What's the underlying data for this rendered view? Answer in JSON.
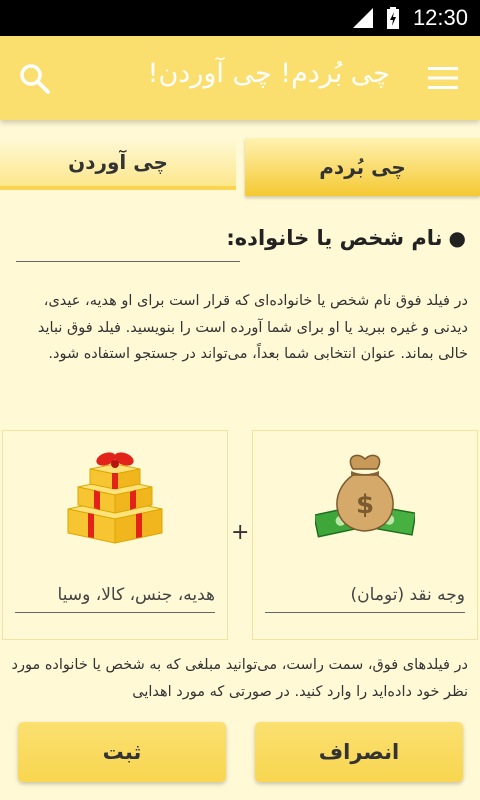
{
  "status": {
    "time": "12:30"
  },
  "appbar": {
    "title": "چی بُردم! چی آوردن!",
    "search_icon": "search-icon",
    "menu_icon": "menu-icon"
  },
  "tabs": [
    {
      "label": "چی آوردن",
      "selected": false
    },
    {
      "label": "چی بُردم",
      "selected": true
    }
  ],
  "form": {
    "name_label": "نام شخص یا خانواده:",
    "name_value": "",
    "description": "در فیلد فوق نام شخص یا خانواده‌ای که قرار است برای او هدیه، عیدی، دیدنی و غیره ببرید یا او برای شما آورده است را بنویسید. فیلد فوق نباید خالی بماند. عنوان انتخابی شما بعداً، می‌تواند در جستجو استفاده شود.",
    "cash": {
      "icon": "money-bag-icon",
      "placeholder": "وجه نقد (تومان)"
    },
    "gift": {
      "icon": "gift-boxes-icon",
      "placeholder": "هدیه، جنس، کالا، وسیا"
    },
    "plus": "+",
    "description2": "در فیلدهای فوق، سمت راست، می‌توانید مبلغی که به شخص یا خانواده مورد نظر خود داده‌اید را وارد کنید. در صورتی که مورد اهدایی"
  },
  "buttons": {
    "submit": "ثبت",
    "cancel": "انصراف"
  },
  "colors": {
    "background": "#FFF9D6",
    "appbar": "#FADF6E",
    "tab_selected": "#F5C933",
    "button": "#F8D650"
  }
}
